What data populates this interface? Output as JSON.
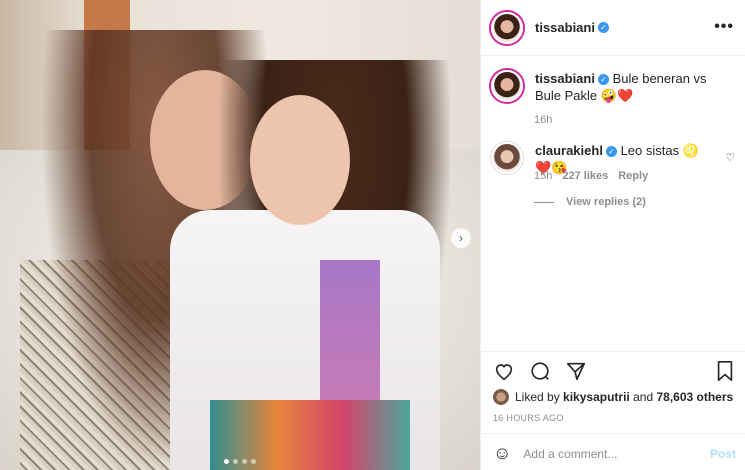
{
  "post": {
    "username": "tissabiani",
    "photo_dots": 4,
    "active_dot": 0
  },
  "caption": {
    "username": "tissabiani",
    "text": "Bule beneran vs Bule Pakle",
    "emoji": "🤪❤️",
    "time": "16h"
  },
  "comment": {
    "username": "claurakiehl",
    "text": "Leo sistas",
    "emoji": "♌❤️😘",
    "time": "15h",
    "likes": "227 likes",
    "reply": "Reply",
    "view_replies": "View replies (2)"
  },
  "likes": {
    "prefix": "Liked by",
    "user": "kikysaputrii",
    "and": "and",
    "others": "78,603 others"
  },
  "timestamp": "16 HOURS AGO",
  "add_comment": {
    "placeholder": "Add a comment...",
    "post_label": "Post"
  },
  "colors": {
    "verified": "#3897f0",
    "story_ring": "#d6249f",
    "post_button": "#b2dffc"
  }
}
